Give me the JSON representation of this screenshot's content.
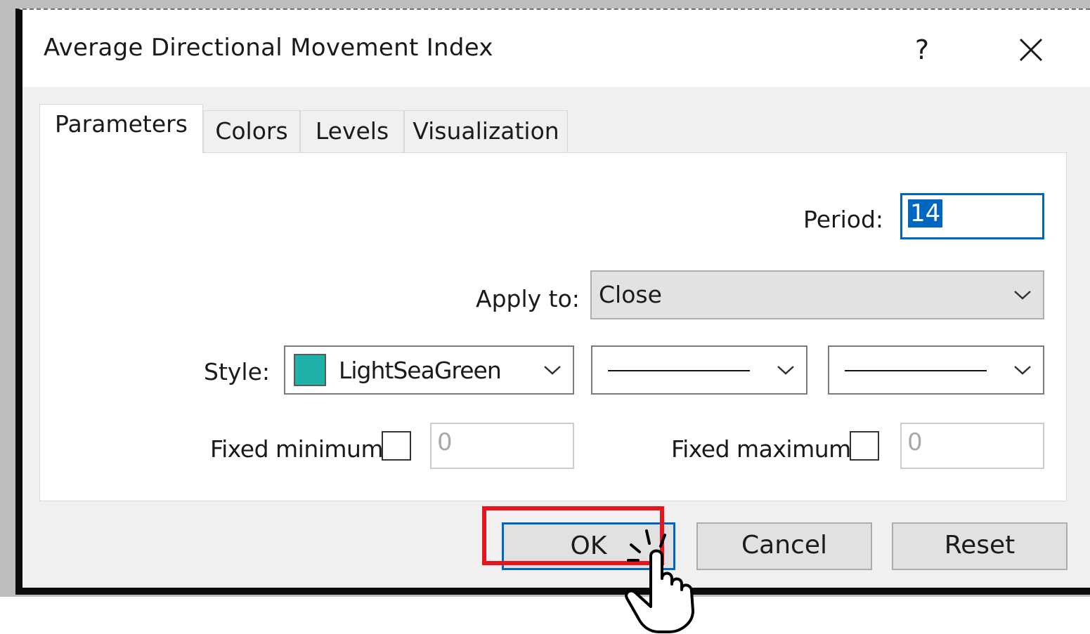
{
  "dialog": {
    "title": "Average Directional Movement Index",
    "help_label": "?"
  },
  "tabs": [
    {
      "label": "Parameters",
      "active": true
    },
    {
      "label": "Colors",
      "active": false
    },
    {
      "label": "Levels",
      "active": false
    },
    {
      "label": "Visualization",
      "active": false
    }
  ],
  "parameters": {
    "period_label": "Period:",
    "period_value": "14",
    "apply_to_label": "Apply to:",
    "apply_to_value": "Close",
    "style_label": "Style:",
    "style_color_name": "LightSeaGreen",
    "style_color_hex": "#20b2aa",
    "fixed_minimum_label": "Fixed minimum",
    "fixed_minimum_checked": false,
    "fixed_minimum_value": "0",
    "fixed_maximum_label": "Fixed maximum",
    "fixed_maximum_checked": false,
    "fixed_maximum_value": "0"
  },
  "buttons": {
    "ok": "OK",
    "cancel": "Cancel",
    "reset": "Reset"
  },
  "colors": {
    "accent": "#0067c0",
    "highlight": "#e8141b"
  },
  "icons": {
    "close": "close-icon",
    "chevron": "chevron-down-icon",
    "cursor": "pointer-hand-icon"
  }
}
